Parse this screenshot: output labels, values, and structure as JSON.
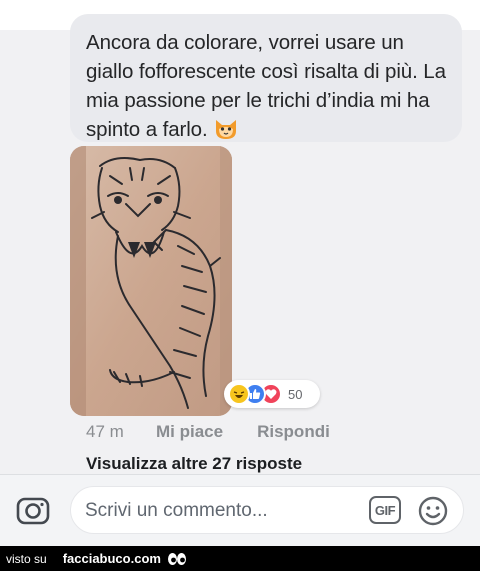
{
  "comment": {
    "text": "Ancora da colorare, vorrei usare un giallo fofforescente così risalta di più. La mia passione per le trichi d’india mi ha spinto a farlo.",
    "emoji_icon": "cat-emoji",
    "photo_icon": "tiger-tattoo-photo"
  },
  "reactions": {
    "icons": [
      "haha-icon",
      "like-icon",
      "love-icon"
    ],
    "count": "50"
  },
  "actions": {
    "time": "47 m",
    "like_label": "Mi piace",
    "reply_label": "Rispondi"
  },
  "more_replies": "Visualizza altre 27 risposte",
  "composer": {
    "placeholder": "Scrivi un commento...",
    "gif_label": "GIF",
    "camera_icon": "camera-icon",
    "emoji_icon": "smiley-icon"
  },
  "footer": {
    "prefix": "visto su",
    "brand": "facciabuco.com",
    "logo_icon": "eyes-logo-icon"
  },
  "colors": {
    "bubble": "#e9eaee",
    "like": "#3f7ff0",
    "love": "#f0435a",
    "haha": "#f7c51e",
    "footer": "#000000"
  }
}
